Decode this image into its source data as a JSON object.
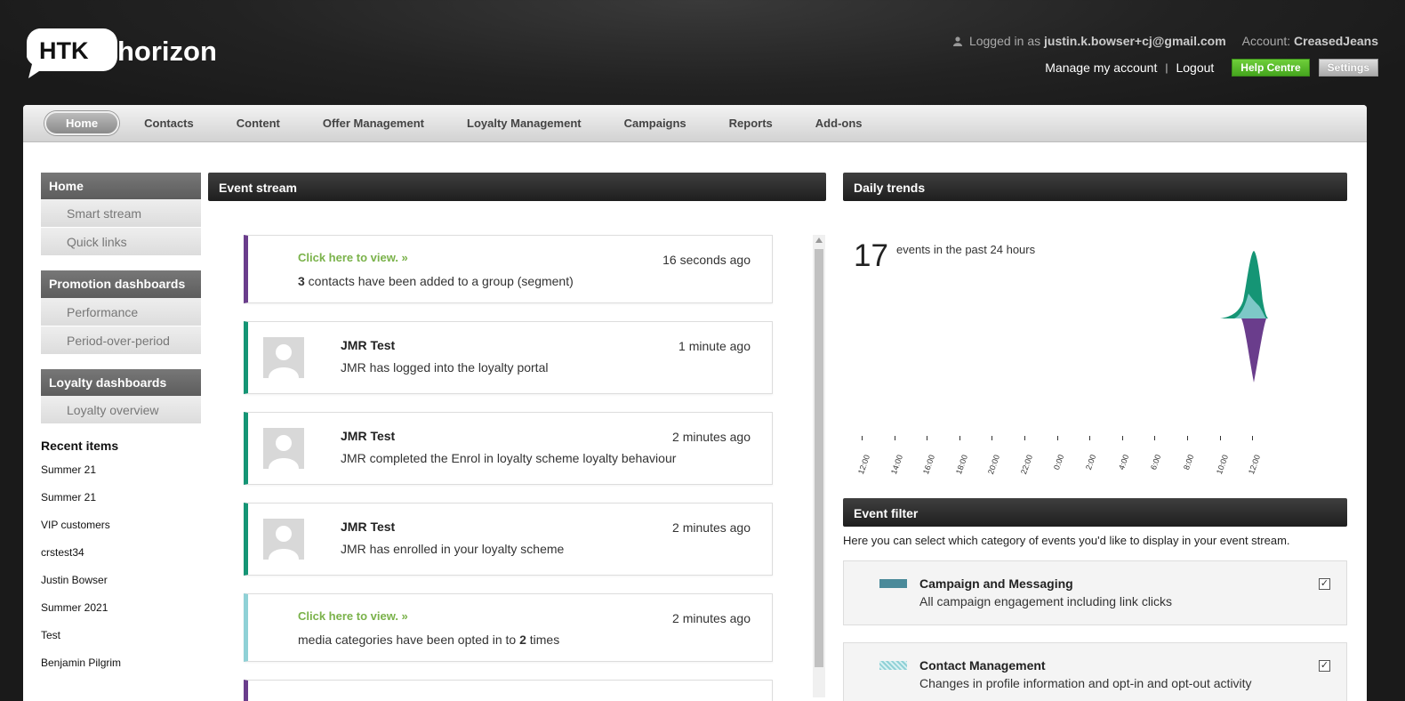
{
  "header": {
    "logo_text_left": "HTK",
    "logo_text_right": "horizon",
    "logged_in_prefix": "Logged in as",
    "user_email": "justin.k.bowser+cj@gmail.com",
    "account_prefix": "Account:",
    "account_name": "CreasedJeans",
    "manage_account": "Manage my account",
    "separator": "|",
    "logout": "Logout",
    "help_centre": "Help Centre",
    "settings": "Settings"
  },
  "nav": {
    "items": [
      "Home",
      "Contacts",
      "Content",
      "Offer Management",
      "Loyalty Management",
      "Campaigns",
      "Reports",
      "Add-ons"
    ]
  },
  "sidebar": {
    "groups": [
      {
        "title": "Home",
        "items": [
          "Smart stream",
          "Quick links"
        ]
      },
      {
        "title": "Promotion dashboards",
        "items": [
          "Performance",
          "Period-over-period"
        ]
      },
      {
        "title": "Loyalty dashboards",
        "items": [
          "Loyalty overview"
        ]
      }
    ],
    "recent_title": "Recent items",
    "recent_items": [
      "Summer 21",
      "Summer 21",
      "VIP customers",
      "crstest34",
      "Justin Bowser",
      "Summer 2021",
      "Test",
      "Benjamin Pilgrim"
    ]
  },
  "event_stream": {
    "title": "Event stream",
    "cards": [
      {
        "view": "Click here to view. »",
        "time": "16 seconds ago",
        "count": "3",
        "text": " contacts have been added to a group (segment)"
      },
      {
        "name": "JMR Test",
        "time": "1 minute ago",
        "text": "JMR has logged into the loyalty portal"
      },
      {
        "name": "JMR Test",
        "time": "2 minutes ago",
        "text": "JMR completed the Enrol in loyalty scheme loyalty behaviour"
      },
      {
        "name": "JMR Test",
        "time": "2 minutes ago",
        "text": "JMR has enrolled in your loyalty scheme"
      },
      {
        "view": "Click here to view. »",
        "time": "2 minutes ago",
        "text_before": "media categories have been opted in to ",
        "count": "2",
        "text_after": " times"
      }
    ]
  },
  "daily_trends": {
    "title": "Daily trends",
    "count": "17",
    "label": "events in the past 24 hours",
    "colors": {
      "top": "#159575",
      "bottom": "#6a3d8c",
      "mid": "#8fd1d6"
    }
  },
  "chart_data": {
    "type": "area",
    "x": [
      "12:00",
      "14:00",
      "16:00",
      "18:00",
      "20:00",
      "22:00",
      "0:00",
      "2:00",
      "4:00",
      "6:00",
      "8:00",
      "10:00",
      "12:00"
    ]
  },
  "event_filter": {
    "title": "Event filter",
    "intro": "Here you can select which category of events you'd like to display in your event stream.",
    "items": [
      {
        "name": "Campaign and Messaging",
        "desc": "All campaign engagement including link clicks",
        "color": "#4a8a9a",
        "checked": "✓"
      },
      {
        "name": "Contact Management",
        "desc": "Changes in profile information and opt-in and opt-out activity",
        "color": "#8fd1d6",
        "checked": "✓"
      }
    ]
  }
}
